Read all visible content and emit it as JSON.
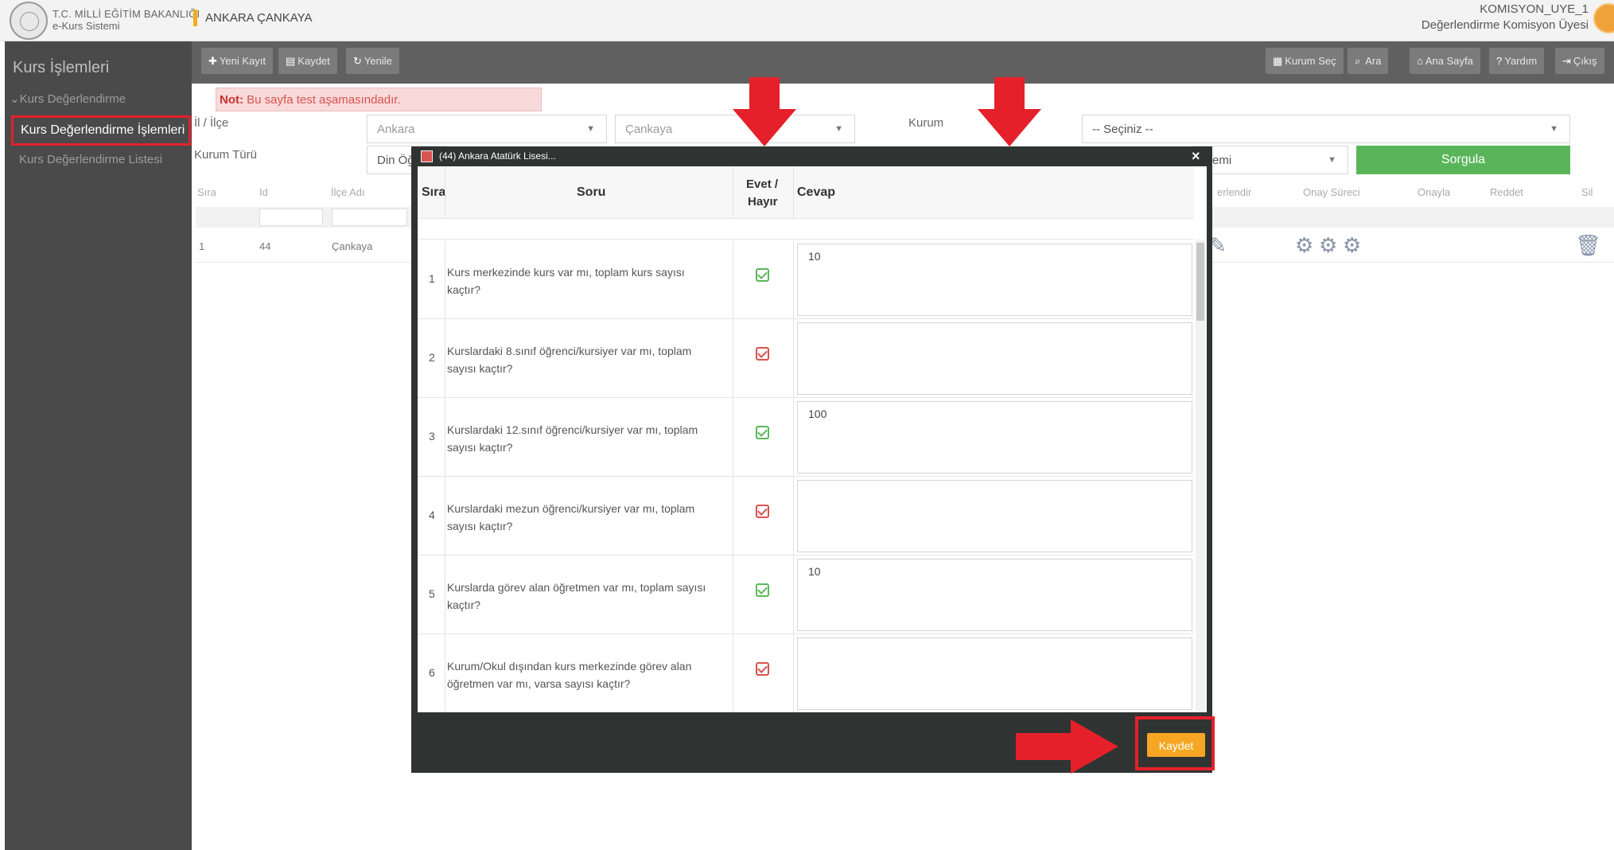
{
  "header": {
    "ministry": "T.C. MİLLİ EĞİTİM BAKANLIĞI",
    "system": "e-Kurs Sistemi",
    "location": "ANKARA ÇANKAYA",
    "user_name": "KOMISYON_UYE_1",
    "user_role": "Değerlendirme Komisyon Üyesi"
  },
  "sidebar": {
    "title": "Kurs İşlemleri",
    "group": "Kurs Değerlendirme",
    "items": [
      "Kurs Değerlendirme İşlemleri",
      "Kurs Değerlendirme Listesi"
    ]
  },
  "toolbar": {
    "left": [
      "Yeni Kayıt",
      "Kaydet",
      "Yenile"
    ],
    "right": [
      "Kurum Seç",
      "Ara",
      "Ana Sayfa",
      "Yardım",
      "Çıkış"
    ]
  },
  "form": {
    "note_label": "Not:",
    "note_text": "Bu sayfa test aşamasındadır.",
    "il_ilce_label": "İl / İlçe",
    "il_value": "Ankara",
    "ilce_value": "Çankaya",
    "kurum_label": "Kurum",
    "kurum_value": "-- Seçiniz --",
    "kurum_turu_label": "Kurum Türü",
    "kurum_turu_value": "Din Öğ",
    "extra_select_value": "emi",
    "query_button": "Sorgula"
  },
  "table": {
    "headers": [
      "Sıra",
      "Id",
      "İlçe Adı",
      "erlendir",
      "Onay Süreci",
      "Onayla",
      "Reddet",
      "Sil"
    ],
    "row": [
      "1",
      "44",
      "Çankaya"
    ]
  },
  "modal": {
    "title": "(44) Ankara Atatürk Lisesi...",
    "close": "×",
    "col_sira": "Sıra",
    "col_soru": "Soru",
    "col_evet": "Evet /",
    "col_hayir": "Hayır",
    "col_cevap": "Cevap",
    "questions": [
      {
        "no": "1",
        "text": "Kurs merkezinde kurs var mı, toplam kurs sayısı kaçtır?",
        "answer": "10",
        "status": "yes"
      },
      {
        "no": "2",
        "text": "Kurslardaki 8.sınıf öğrenci/kursiyer var mı, toplam sayısı kaçtır?",
        "answer": "",
        "status": "no"
      },
      {
        "no": "3",
        "text": "Kurslardaki 12.sınıf öğrenci/kursiyer var mı, toplam sayısı kaçtır?",
        "answer": "100",
        "status": "yes"
      },
      {
        "no": "4",
        "text": "Kurslardaki mezun öğrenci/kursiyer var mı, toplam sayısı kaçtır?",
        "answer": "",
        "status": "no"
      },
      {
        "no": "5",
        "text": "Kurslarda görev alan öğretmen var mı, toplam sayısı kaçtır?",
        "answer": "10",
        "status": "yes"
      },
      {
        "no": "6",
        "text": "Kurum/Okul dışından kurs merkezinde görev alan öğretmen var mı, varsa sayısı kaçtır?",
        "answer": "",
        "status": "no"
      }
    ],
    "save_button": "Kaydet"
  },
  "colors": {
    "accent_red": "#e5202a",
    "save_orange": "#f5a623",
    "query_green": "#5ab55a",
    "yes_green": "#5cb85c",
    "no_red": "#d9534f"
  }
}
